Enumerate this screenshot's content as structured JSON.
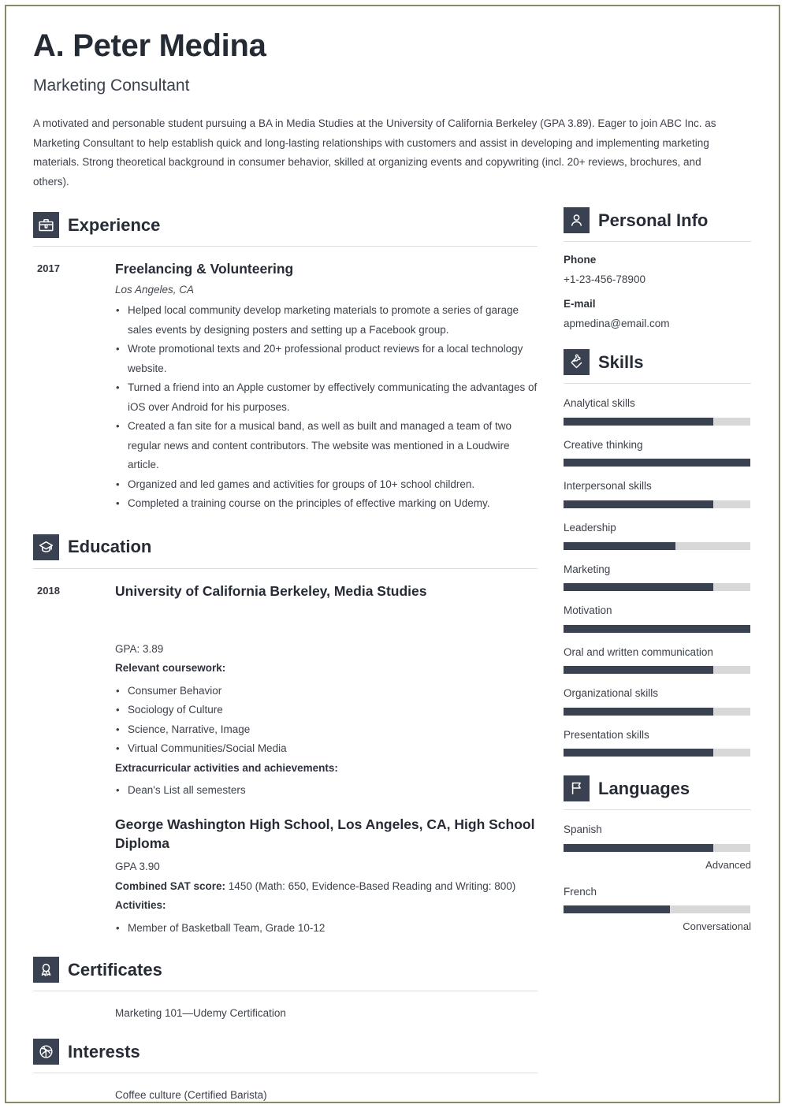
{
  "theme": {
    "accent_dark": "#3a4151",
    "bar_track": "#d8d8d8",
    "page_border": "#8a8a6a",
    "text": "#3c414a"
  },
  "header": {
    "name": "A. Peter Medina",
    "job_title": "Marketing Consultant",
    "summary": "A motivated and personable student pursuing a BA in Media Studies at the University of California Berkeley (GPA 3.89). Eager to join ABC Inc. as Marketing Consultant to help establish quick and long-lasting relationships with customers and assist in developing and implementing marketing materials. Strong theoretical background in consumer behavior, skilled at organizing events and copywriting (incl. 20+ reviews, brochures, and others)."
  },
  "experience": {
    "title": "Experience",
    "icon": "briefcase-icon",
    "entries": [
      {
        "date": "2017",
        "title": "Freelancing & Volunteering",
        "subtitle": "Los Angeles, CA",
        "bullets": [
          "Helped local community develop marketing materials to promote a series of garage sales events by designing posters and setting up a Facebook group.",
          "Wrote promotional texts and 20+ professional product reviews for a local technology website.",
          "Turned a friend into an Apple customer by effectively communicating the advantages of iOS over Android for his purposes.",
          "Created a fan site for a musical band, as well as built and managed a team of two regular news and content contributors. The website was mentioned in a Loudwire article.",
          "Organized and led games and activities for groups of 10+ school children.",
          "Completed a training course on the principles of effective marking on Udemy."
        ]
      }
    ]
  },
  "education": {
    "title": "Education",
    "icon": "graduation-cap-icon",
    "entries": [
      {
        "date": "2018",
        "title": "University of California Berkeley, Media Studies",
        "subtitle": "",
        "gpa": "GPA: 3.89",
        "coursework_label": "Relevant coursework:",
        "coursework": [
          "Consumer Behavior",
          "Sociology of Culture",
          "Science, Narrative, Image",
          "Virtual Communities/Social Media"
        ],
        "extracurricular_label": "Extracurricular activities and achievements:",
        "extracurricular": [
          "Dean's List all semesters"
        ]
      },
      {
        "date": "",
        "title": "George Washington High School, Los Angeles, CA, High School Diploma",
        "gpa": "GPA 3.90",
        "sat_label": "Combined SAT score:",
        "sat_value": "1450 (Math: 650, Evidence-Based Reading and Writing: 800)",
        "activities_label": "Activities:",
        "activities": [
          "Member of Basketball Team, Grade 10-12"
        ]
      }
    ]
  },
  "certificates": {
    "title": "Certificates",
    "icon": "award-ribbon-icon",
    "items": [
      "Marketing 101—Udemy Certification"
    ]
  },
  "interests": {
    "title": "Interests",
    "icon": "basketball-icon",
    "items": [
      "Coffee culture (Certified Barista)"
    ]
  },
  "personal_info": {
    "title": "Personal Info",
    "icon": "person-icon",
    "fields": [
      {
        "label": "Phone",
        "value": "+1-23-456-78900"
      },
      {
        "label": "E-mail",
        "value": "apmedina@email.com"
      }
    ]
  },
  "skills": {
    "title": "Skills",
    "icon": "puzzle-piece-icon",
    "items": [
      {
        "name": "Analytical skills",
        "level": 80
      },
      {
        "name": "Creative thinking",
        "level": 100
      },
      {
        "name": "Interpersonal skills",
        "level": 80
      },
      {
        "name": "Leadership",
        "level": 60
      },
      {
        "name": "Marketing",
        "level": 80
      },
      {
        "name": "Motivation",
        "level": 100
      },
      {
        "name": "Oral and written communication",
        "level": 80
      },
      {
        "name": "Organizational skills",
        "level": 80
      },
      {
        "name": "Presentation skills",
        "level": 80
      }
    ]
  },
  "languages": {
    "title": "Languages",
    "icon": "flag-icon",
    "items": [
      {
        "name": "Spanish",
        "level": 80,
        "level_label": "Advanced"
      },
      {
        "name": "French",
        "level": 57,
        "level_label": "Conversational"
      }
    ]
  }
}
